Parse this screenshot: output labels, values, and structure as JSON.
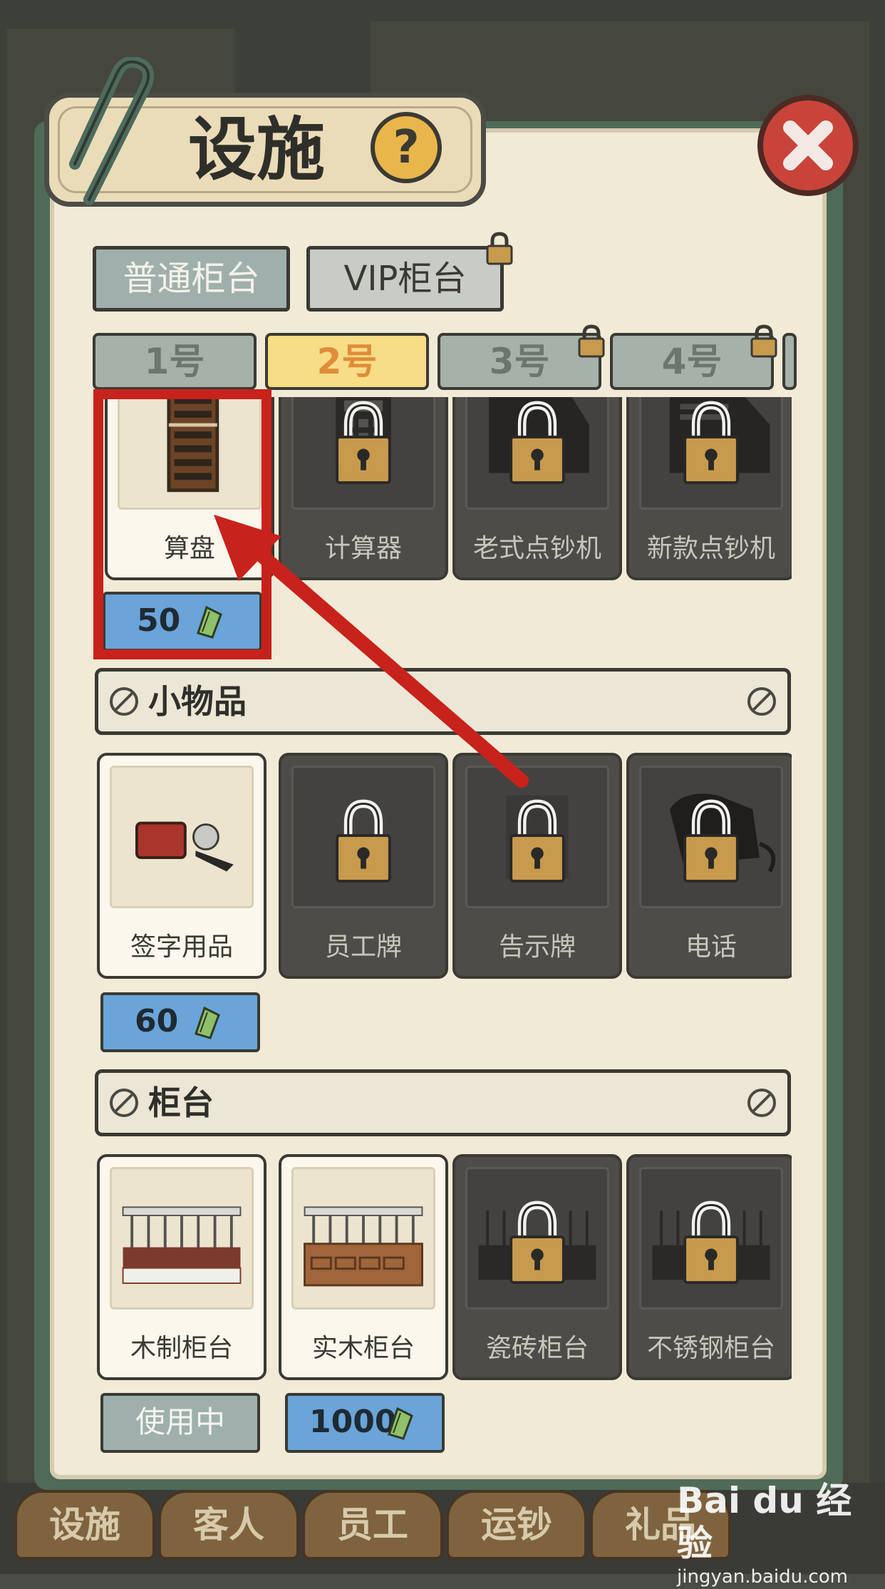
{
  "title": "设施",
  "help_symbol": "?",
  "type_tabs": [
    {
      "label": "普通柜台",
      "locked": false
    },
    {
      "label": "VIP柜台",
      "locked": true
    }
  ],
  "number_tabs": [
    {
      "label": "1号",
      "active": false,
      "locked": false
    },
    {
      "label": "2号",
      "active": true,
      "locked": false
    },
    {
      "label": "3号",
      "active": false,
      "locked": true
    },
    {
      "label": "4号",
      "active": false,
      "locked": true
    }
  ],
  "tools_row": {
    "items": [
      {
        "name": "算盘",
        "locked": false,
        "icon": "abacus-icon"
      },
      {
        "name": "计算器",
        "locked": true,
        "icon": "calculator-icon"
      },
      {
        "name": "老式点钞机",
        "locked": true,
        "icon": "old-money-counter-icon"
      },
      {
        "name": "新款点钞机",
        "locked": true,
        "icon": "new-money-counter-icon"
      }
    ],
    "prices": [
      "50"
    ]
  },
  "small_items_section": {
    "label": "小物品",
    "items": [
      {
        "name": "签字用品",
        "locked": false,
        "icon": "signing-supplies-icon"
      },
      {
        "name": "员工牌",
        "locked": true,
        "icon": "staff-badge-icon"
      },
      {
        "name": "告示牌",
        "locked": true,
        "icon": "notice-board-icon"
      },
      {
        "name": "电话",
        "locked": true,
        "icon": "telephone-icon"
      }
    ],
    "prices": [
      "60"
    ]
  },
  "counter_section": {
    "label": "柜台",
    "items": [
      {
        "name": "木制柜台",
        "locked": false,
        "icon": "wooden-counter-icon"
      },
      {
        "name": "实木柜台",
        "locked": false,
        "icon": "solid-wood-counter-icon"
      },
      {
        "name": "瓷砖柜台",
        "locked": true,
        "icon": "tile-counter-icon"
      },
      {
        "name": "不锈钢柜台",
        "locked": true,
        "icon": "steel-counter-icon"
      }
    ],
    "in_use_label": "使用中",
    "price": "1000"
  },
  "bottom_tabs": [
    "设施",
    "客人",
    "员工",
    "运钞",
    "礼品"
  ],
  "watermark": {
    "logo": "Bai du 经验",
    "url": "jingyan.baidu.com"
  },
  "colors": {
    "highlight": "#c8221c",
    "price_bg": "#6aa4d9",
    "active_tab": "#f6dd86",
    "close": "#c8443a",
    "panel": "#f1ead7"
  }
}
